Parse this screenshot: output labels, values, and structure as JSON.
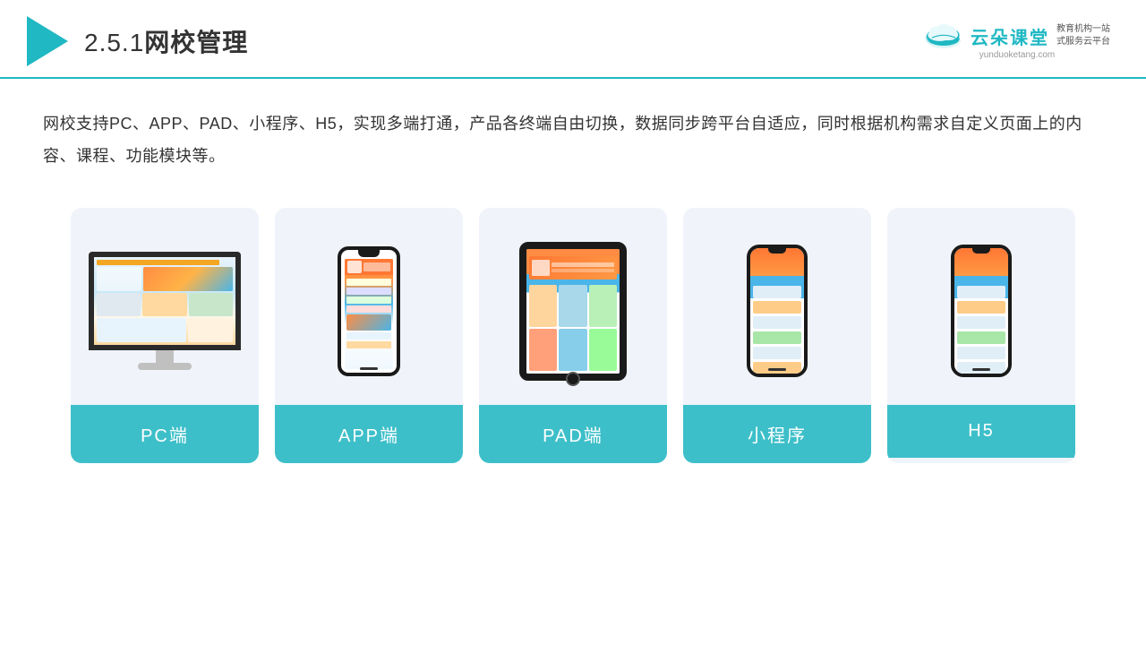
{
  "header": {
    "title": "2.5.1网校管理",
    "title_prefix": "2.5.1",
    "title_main": "网校管理",
    "brand_name": "云朵课堂",
    "brand_url": "yunduoketang.com",
    "brand_tagline": "教育机构一站\n式服务云平台"
  },
  "description": {
    "text": "网校支持PC、APP、PAD、小程序、H5，实现多端打通，产品各终端自由切换，数据同步跨平台自适应，同时根据机构需求自定义页面上的内容、课程、功能模块等。"
  },
  "cards": [
    {
      "id": "pc",
      "label": "PC端"
    },
    {
      "id": "app",
      "label": "APP端"
    },
    {
      "id": "pad",
      "label": "PAD端"
    },
    {
      "id": "miniprogram",
      "label": "小程序"
    },
    {
      "id": "h5",
      "label": "H5"
    }
  ],
  "colors": {
    "teal": "#3dbfc9",
    "header_line": "#1fb8c3",
    "triangle": "#1fb8c3",
    "text_dark": "#333333",
    "card_bg": "#f0f4fa"
  }
}
